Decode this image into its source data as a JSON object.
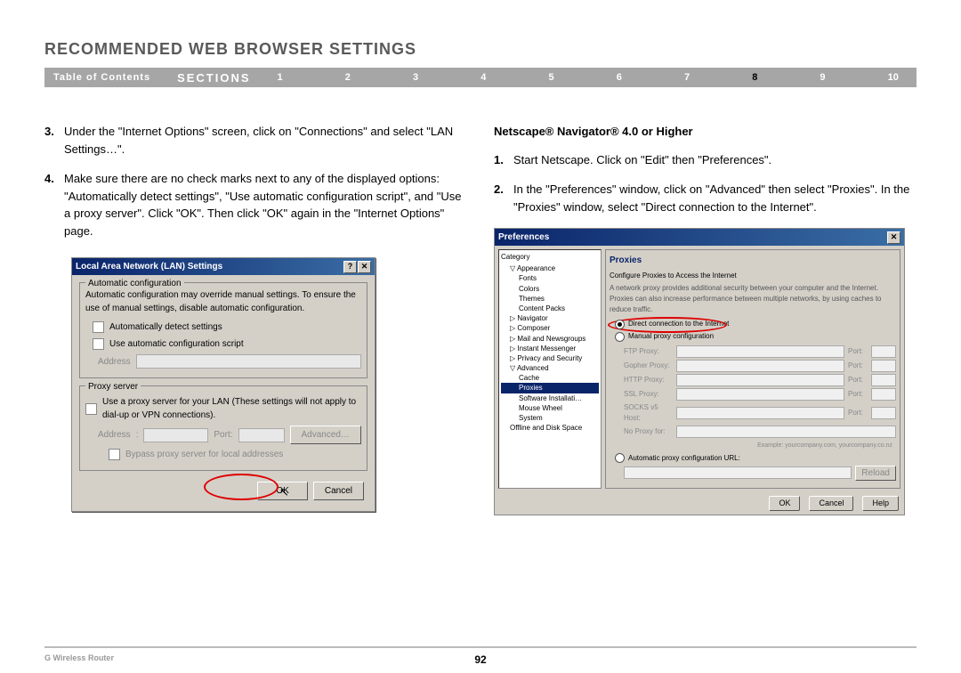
{
  "title": "RECOMMENDED WEB BROWSER SETTINGS",
  "navbar": {
    "toc": "Table of Contents",
    "sections_label": "SECTIONS",
    "sections": [
      "1",
      "2",
      "3",
      "4",
      "5",
      "6",
      "7",
      "8",
      "9",
      "10"
    ],
    "active": "8"
  },
  "left_col": {
    "steps": [
      {
        "num": "3.",
        "text": "Under the \"Internet Options\" screen, click on \"Connections\" and select \"LAN Settings…\"."
      },
      {
        "num": "4.",
        "text": "Make sure there are no check marks next to any of the displayed options: \"Automatically detect settings\", \"Use automatic configuration script\", and \"Use a proxy server\". Click \"OK\". Then click \"OK\" again in the \"Internet Options\" page."
      }
    ]
  },
  "right_col": {
    "heading": "Netscape® Navigator® 4.0 or Higher",
    "steps": [
      {
        "num": "1.",
        "text": "Start Netscape. Click on \"Edit\" then \"Preferences\"."
      },
      {
        "num": "2.",
        "text": "In the \"Preferences\" window, click on \"Advanced\" then select \"Proxies\". In the \"Proxies\" window, select \"Direct connection to the Internet\"."
      }
    ]
  },
  "lan_dialog": {
    "title": "Local Area Network (LAN) Settings",
    "group1_title": "Automatic configuration",
    "group1_desc": "Automatic configuration may override manual settings. To ensure the use of manual settings, disable automatic configuration.",
    "chk1": "Automatically detect settings",
    "chk2": "Use automatic configuration script",
    "address_label": "Address",
    "group2_title": "Proxy server",
    "chk3": "Use a proxy server for your LAN (These settings will not apply to dial-up or VPN connections).",
    "port_label": "Port:",
    "advanced_btn": "Advanced…",
    "chk4": "Bypass proxy server for local addresses",
    "ok_btn": "OK",
    "cancel_btn": "Cancel"
  },
  "pref_dialog": {
    "title": "Preferences",
    "category_label": "Category",
    "tree": {
      "appearance": "Appearance",
      "fonts": "Fonts",
      "colors": "Colors",
      "themes": "Themes",
      "content_packs": "Content Packs",
      "navigator": "Navigator",
      "composer": "Composer",
      "mail": "Mail and Newsgroups",
      "im": "Instant Messenger",
      "privacy": "Privacy and Security",
      "advanced": "Advanced",
      "cache": "Cache",
      "proxies": "Proxies",
      "software": "Software Installati…",
      "mouse": "Mouse Wheel",
      "system": "System",
      "offline": "Offline and Disk Space"
    },
    "panel_title": "Proxies",
    "panel_sub": "Configure Proxies to Access the Internet",
    "panel_desc": "A network proxy provides additional security between your computer and the Internet. Proxies can also increase performance between multiple networks, by using caches to reduce traffic.",
    "radio_direct": "Direct connection to the Internet",
    "radio_manual": "Manual proxy configuration",
    "proxy_rows": [
      {
        "label": "FTP Proxy:",
        "port": "Port:"
      },
      {
        "label": "Gopher Proxy:",
        "port": "Port:"
      },
      {
        "label": "HTTP Proxy:",
        "port": "Port:"
      },
      {
        "label": "SSL Proxy:",
        "port": "Port:"
      },
      {
        "label": "SOCKS v5 Host:",
        "port": "Port:"
      }
    ],
    "no_proxy_label": "No Proxy for:",
    "example": "Example: yourcompany.com, yourcompany.co.nz",
    "radio_auto": "Automatic proxy configuration URL:",
    "reload_btn": "Reload",
    "ok_btn": "OK",
    "cancel_btn": "Cancel",
    "help_btn": "Help"
  },
  "footer": {
    "product": "G Wireless Router",
    "page": "92"
  }
}
